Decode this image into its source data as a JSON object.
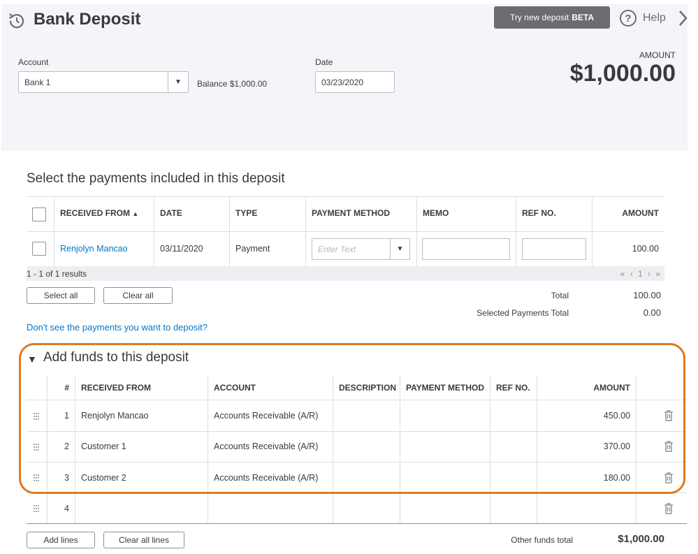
{
  "header": {
    "title": "Bank Deposit",
    "beta_button": "Try new deposit",
    "beta_tag": "BETA",
    "help": "Help",
    "account_label": "Account",
    "account_value": "Bank 1",
    "balance_label": "Balance",
    "balance_value": "$1,000.00",
    "date_label": "Date",
    "date_value": "03/23/2020",
    "amount_label": "AMOUNT",
    "amount_value": "$1,000.00"
  },
  "payments": {
    "title": "Select the payments included in this deposit",
    "columns": [
      "RECEIVED FROM",
      "DATE",
      "TYPE",
      "PAYMENT METHOD",
      "MEMO",
      "REF NO.",
      "AMOUNT"
    ],
    "sort_indicator": "▲",
    "rows": [
      {
        "received_from": "Renjolyn Mancao",
        "date": "03/11/2020",
        "type": "Payment",
        "payment_method_placeholder": "Enter Text",
        "amount": "100.00"
      }
    ],
    "results": "1 - 1 of 1 results",
    "pager": "« ‹ 1 › »",
    "select_all": "Select all",
    "clear_all": "Clear all",
    "total_label": "Total",
    "total_value": "100.00",
    "selected_total_label": "Selected Payments Total",
    "selected_total_value": "0.00",
    "missing_link": "Don't see the payments you want to deposit?"
  },
  "funds": {
    "title": "Add funds to this deposit",
    "columns": [
      "#",
      "RECEIVED FROM",
      "ACCOUNT",
      "DESCRIPTION",
      "PAYMENT METHOD",
      "REF NO.",
      "AMOUNT"
    ],
    "rows": [
      {
        "num": "1",
        "received_from": "Renjolyn Mancao",
        "account": "Accounts Receivable (A/R)",
        "amount": "450.00"
      },
      {
        "num": "2",
        "received_from": "Customer 1",
        "account": "Accounts Receivable (A/R)",
        "amount": "370.00"
      },
      {
        "num": "3",
        "received_from": "Customer 2",
        "account": "Accounts Receivable (A/R)",
        "amount": "180.00"
      },
      {
        "num": "4",
        "received_from": "",
        "account": "",
        "amount": ""
      }
    ],
    "add_lines": "Add lines",
    "clear_all_lines": "Clear all lines",
    "other_total_label": "Other funds total",
    "other_total_value": "$1,000.00"
  },
  "colors": {
    "link": "#0077c5",
    "highlight": "#e07a1f",
    "beta_button_bg": "#6b6c72"
  }
}
